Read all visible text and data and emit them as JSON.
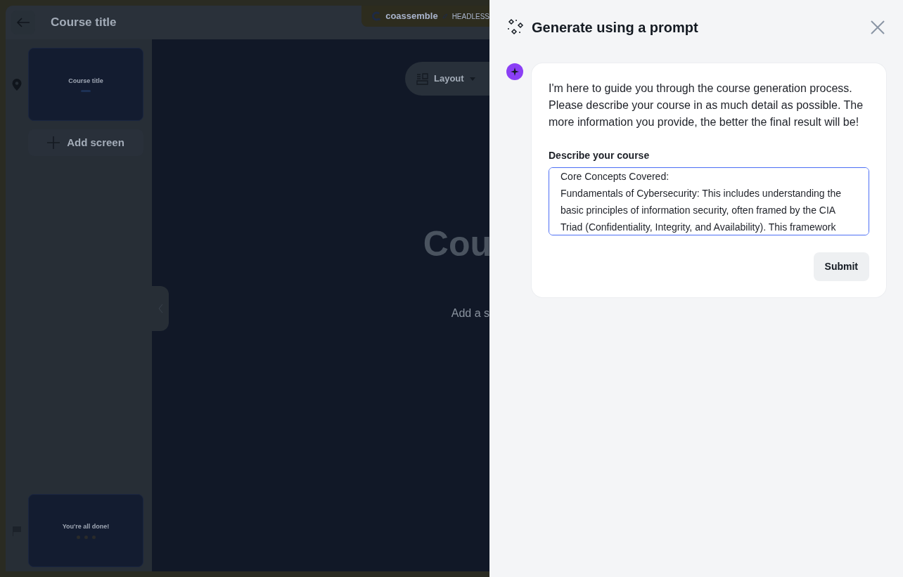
{
  "app": {
    "course_title": "Course title",
    "brand": "coassemble",
    "brand_tag": "HEADLESS",
    "layout_button": "Layout",
    "add_screen": "Add screen",
    "canvas_heading": "Cou",
    "canvas_subtitle": "Add a s",
    "screens": [
      {
        "kind": "title",
        "title": "Course title"
      },
      {
        "kind": "end",
        "title": "You're all done!"
      }
    ]
  },
  "drawer": {
    "title": "Generate using a prompt",
    "message": "I'm here to guide you through the course generation process. Please describe your course in as much detail as possible. The more information you provide, the better the final result will be!",
    "field_label": "Describe your course",
    "field_lines": [
      "Core Concepts Covered:",
      "Fundamentals of Cybersecurity: This includes understanding the",
      "basic principles of information security, often framed by the CIA",
      "Triad (Confidentiality, Integrity, and Availability). This framework"
    ],
    "submit": "Submit"
  }
}
